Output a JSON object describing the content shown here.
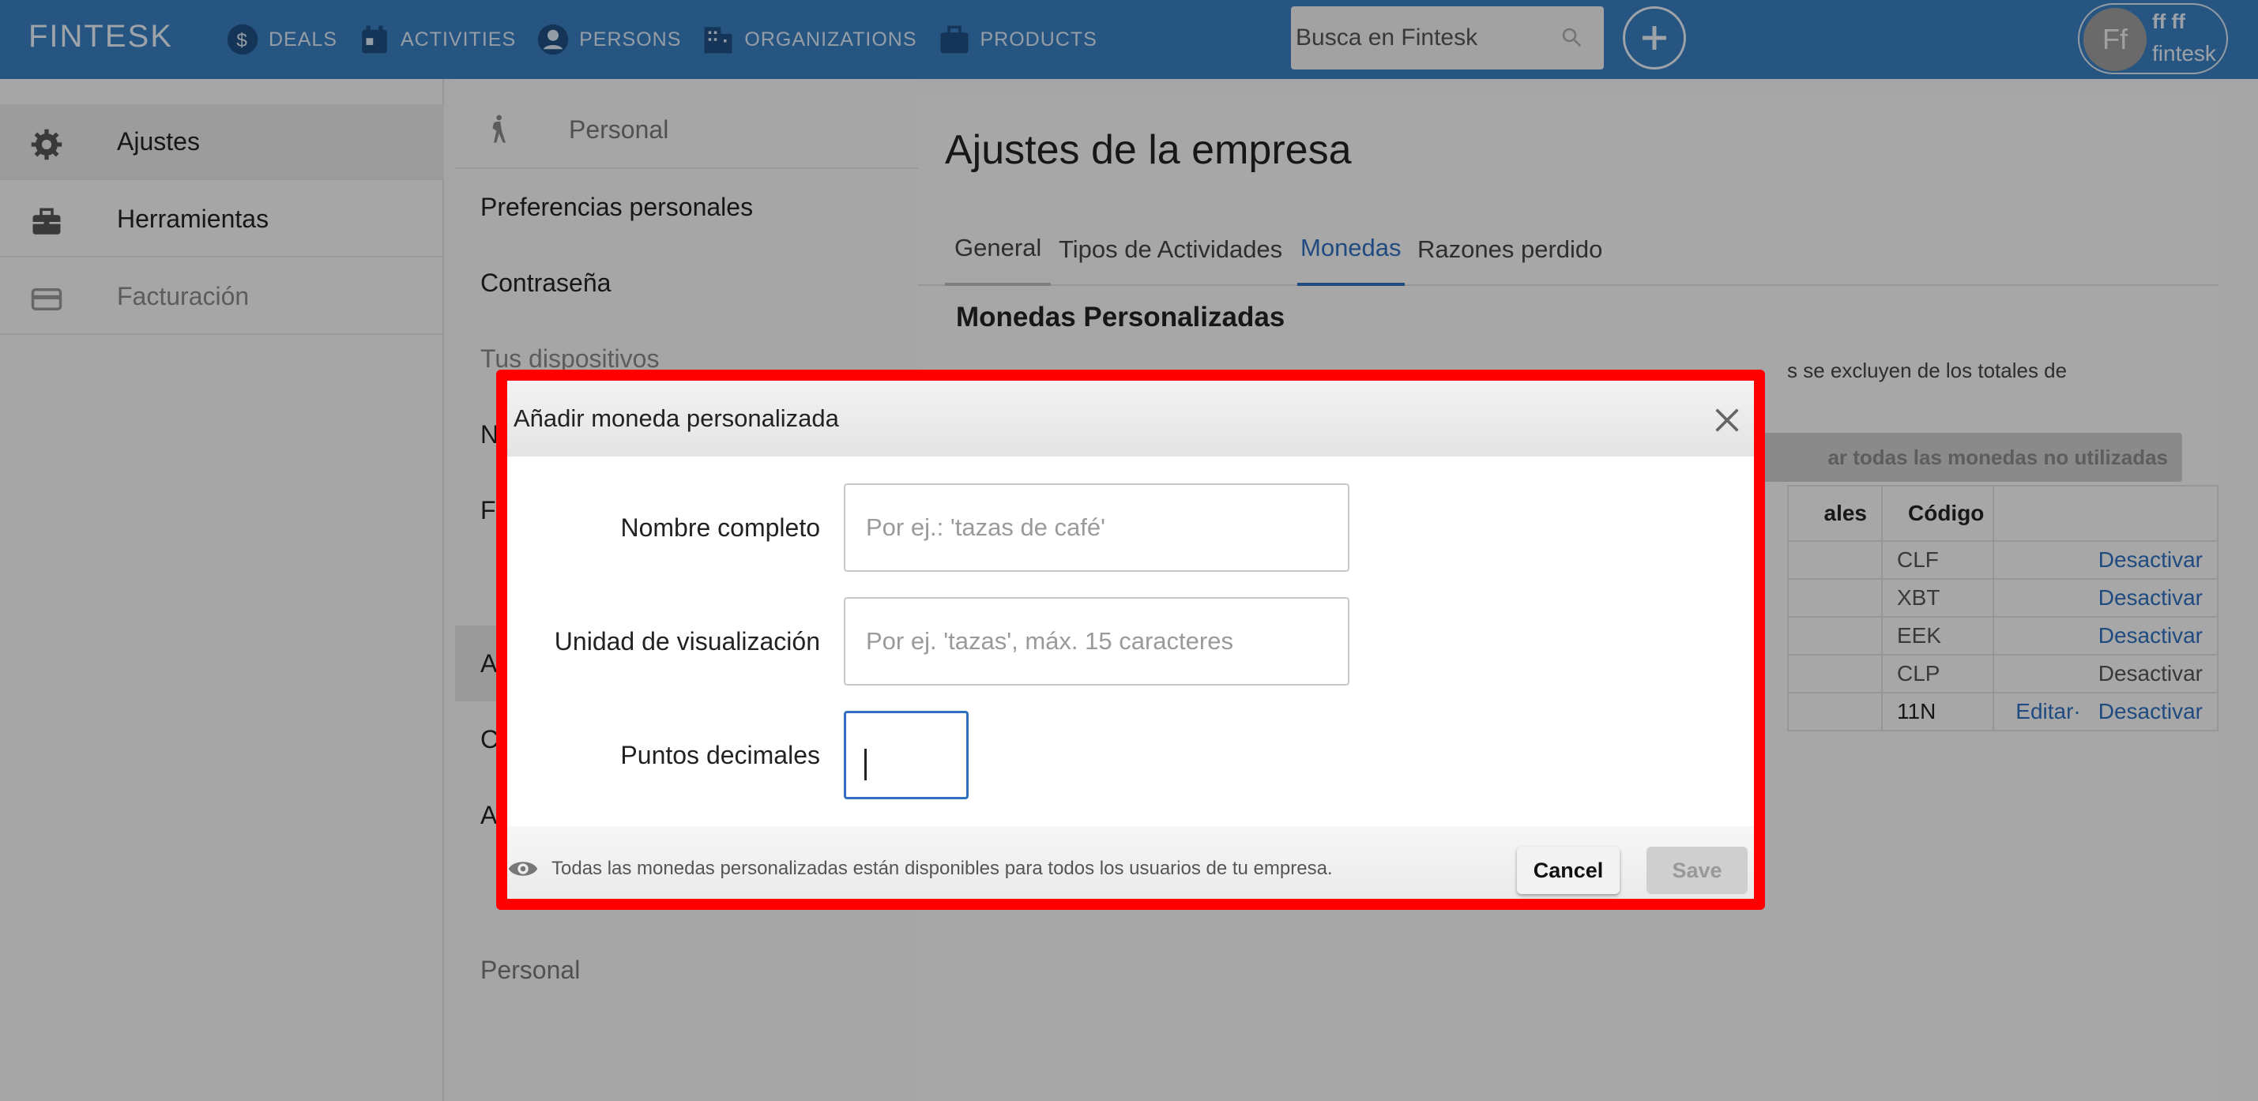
{
  "app": {
    "brand": "FINTESK"
  },
  "nav": [
    {
      "label": "DEALS",
      "icon": "dollar-circle-icon"
    },
    {
      "label": "ACTIVITIES",
      "icon": "calendar-icon"
    },
    {
      "label": "PERSONS",
      "icon": "person-circle-icon"
    },
    {
      "label": "ORGANIZATIONS",
      "icon": "building-icon"
    },
    {
      "label": "PRODUCTS",
      "icon": "briefcase-icon"
    }
  ],
  "search": {
    "text": "Busca en Fintesk"
  },
  "user": {
    "initials": "Ff",
    "name": "ff ff",
    "company": "fintesk"
  },
  "sidebar": {
    "items": [
      {
        "label": "Ajustes",
        "icon": "gear-icon"
      },
      {
        "label": "Herramientas",
        "icon": "toolbox-icon"
      },
      {
        "label": "Facturación",
        "icon": "credit-card-icon"
      }
    ]
  },
  "settings_menu": {
    "header": "Personal",
    "items": [
      "Preferencias personales",
      "Contraseña",
      "Tus dispositivos",
      "N",
      "F",
      "A",
      "C",
      "A"
    ],
    "footer": "Personal"
  },
  "main": {
    "title": "Ajustes de la empresa",
    "tabs": [
      "General",
      "Tipos de Actividades",
      "Monedas",
      "Razones perdido"
    ],
    "active_tab": "Monedas",
    "section_title": "Monedas Personalizadas",
    "section_desc_fragment": "s se excluyen de los totales de",
    "delete_unused_label": "ar todas las monedas no utilizadas",
    "table": {
      "headers": [
        "ales",
        "Código",
        ""
      ],
      "rows": [
        {
          "code": "CLF",
          "edit": "",
          "action": "Desactivar",
          "action_enabled": true
        },
        {
          "code": "XBT",
          "edit": "",
          "action": "Desactivar",
          "action_enabled": true
        },
        {
          "code": "EEK",
          "edit": "",
          "action": "Desactivar",
          "action_enabled": true
        },
        {
          "code": "CLP",
          "edit": "",
          "action": "Desactivar",
          "action_enabled": false
        },
        {
          "code": "11N",
          "edit": "Editar·",
          "action": "Desactivar",
          "action_enabled": true
        }
      ]
    }
  },
  "dialog": {
    "title": "Añadir moneda personalizada",
    "fields": {
      "full_name": {
        "label": "Nombre completo",
        "placeholder": "Por ej.: 'tazas de café'",
        "value": ""
      },
      "display_unit": {
        "label": "Unidad de visualización",
        "placeholder": "Por ej. 'tazas', máx. 15 caracteres",
        "value": ""
      },
      "decimals": {
        "label": "Puntos decimales",
        "value": ""
      }
    },
    "footer_note": "Todas las monedas personalizadas están disponibles para todos los usuarios de tu empresa.",
    "cancel_label": "Cancel",
    "save_label": "Save"
  },
  "colors": {
    "topbar": "#3a7ec0",
    "accent": "#2f6fbf",
    "highlight_border": "#ff0000"
  }
}
